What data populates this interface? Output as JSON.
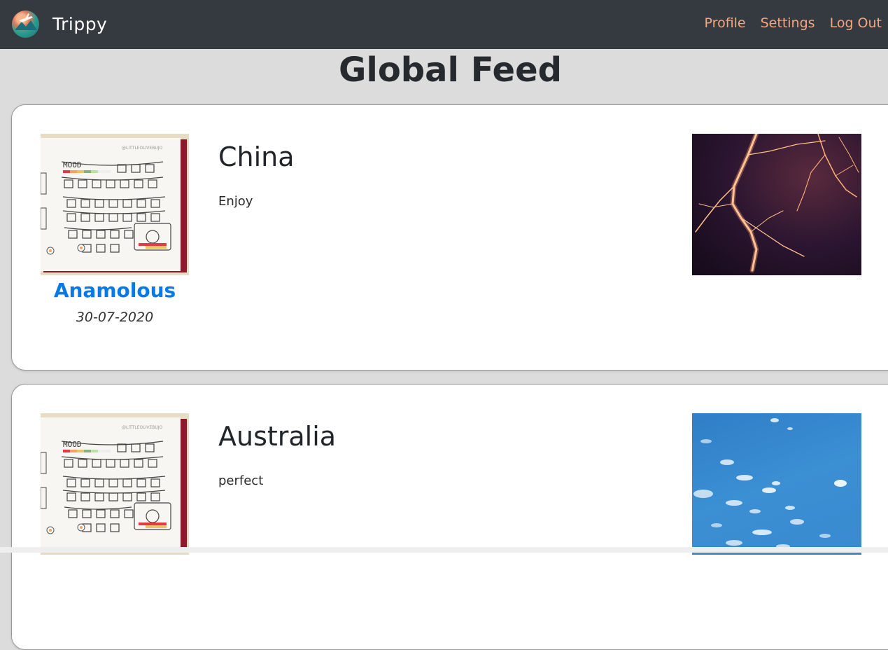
{
  "navbar": {
    "brand": "Trippy",
    "links": [
      "Profile",
      "Settings",
      "Log Out"
    ]
  },
  "page": {
    "title": "Global Feed"
  },
  "posts": [
    {
      "title": "China",
      "body": "Enjoy",
      "username": "Anamolous",
      "date": "30-07-2020",
      "image": "lightning-photo"
    },
    {
      "title": "Australia",
      "body": "perfect",
      "username": "",
      "date": "",
      "image": "sky-photo"
    }
  ],
  "avatar_text": {
    "mood": "MOOD",
    "credit": "@LITTLEOLIVEBUJO"
  },
  "colors": {
    "navbar_bg": "#343a40",
    "nav_link": "#f4a582",
    "username": "#0a79e8",
    "page_bg": "#dcdcdc"
  }
}
